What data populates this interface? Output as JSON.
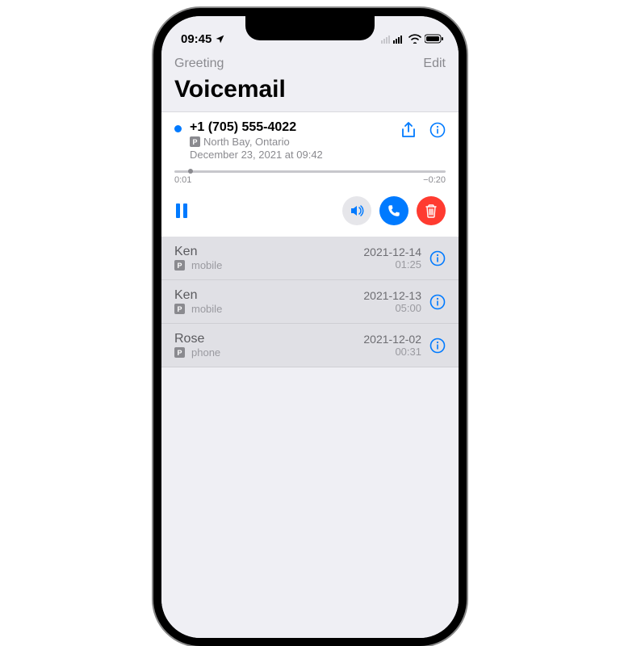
{
  "statusbar": {
    "time": "09:45"
  },
  "nav": {
    "left": "Greeting",
    "right": "Edit"
  },
  "title": "Voicemail",
  "expanded": {
    "number": "+1 (705) 555-4022",
    "location": "North Bay, Ontario",
    "datetime": "December 23, 2021 at 09:42",
    "elapsed": "0:01",
    "remaining": "−0:20"
  },
  "list": [
    {
      "name": "Ken",
      "label": "mobile",
      "date": "2021-12-14",
      "duration": "01:25"
    },
    {
      "name": "Ken",
      "label": "mobile",
      "date": "2021-12-13",
      "duration": "05:00"
    },
    {
      "name": "Rose",
      "label": "phone",
      "date": "2021-12-02",
      "duration": "00:31"
    }
  ]
}
